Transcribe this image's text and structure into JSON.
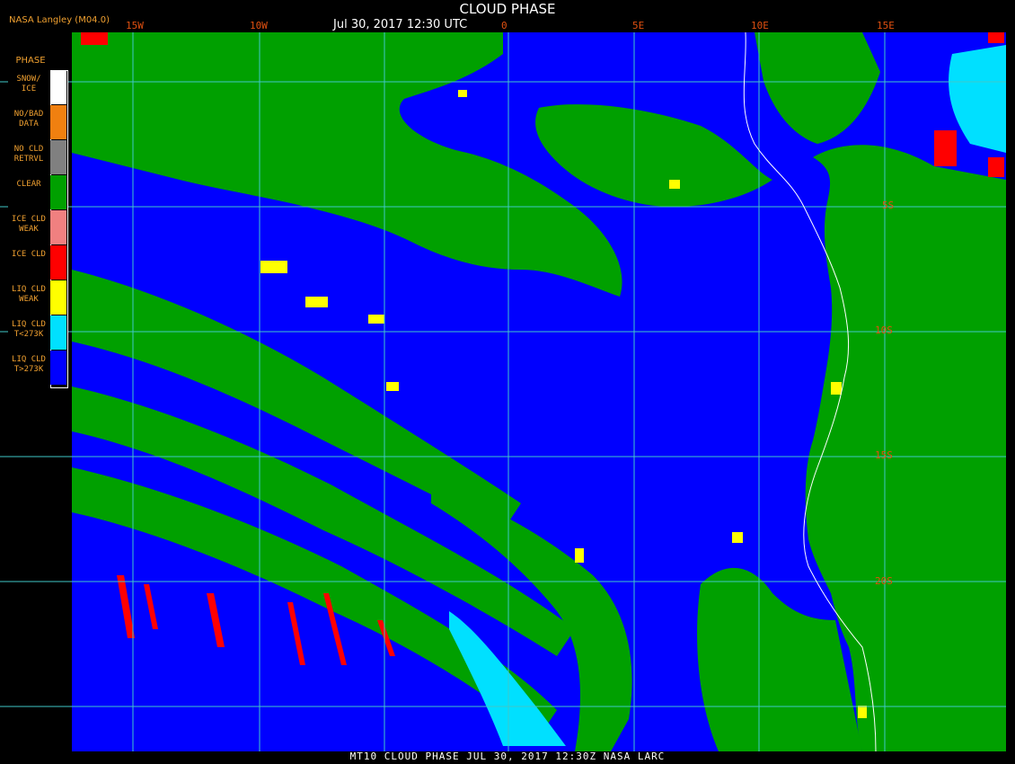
{
  "header": {
    "title": "CLOUD PHASE",
    "date": "Jul 30, 2017 12:30 UTC",
    "credit": "NASA Langley (M04.0)"
  },
  "footer": "MT10  CLOUD PHASE  JUL 30, 2017 12:30Z  NASA LARC",
  "lon_labels": [
    "15W",
    "10W",
    "0",
    "5E",
    "10E",
    "15E"
  ],
  "lat_labels": [
    "5S",
    "10S",
    "15S",
    "20S"
  ],
  "legend": {
    "heading": "PHASE",
    "items": [
      {
        "label": "SNOW/\nICE",
        "color": "#ffffff"
      },
      {
        "label": "NO/BAD\nDATA",
        "color": "#f08010"
      },
      {
        "label": "NO CLD\nRETRVL",
        "color": "#808080"
      },
      {
        "label": "CLEAR",
        "color": "#00a000"
      },
      {
        "label": "ICE CLD\nWEAK",
        "color": "#f08080"
      },
      {
        "label": "ICE CLD",
        "color": "#ff0000"
      },
      {
        "label": "LIQ CLD\nWEAK",
        "color": "#ffff00"
      },
      {
        "label": "LIQ CLD\nT<273K",
        "color": "#00e0ff"
      },
      {
        "label": "LIQ CLD\nT>273K",
        "color": "#0000ff"
      }
    ]
  },
  "colors": {
    "grid": "#40c8c8",
    "ocean_cloud": "#0000ff",
    "clear": "#00a000",
    "coast": "#ffffff"
  }
}
